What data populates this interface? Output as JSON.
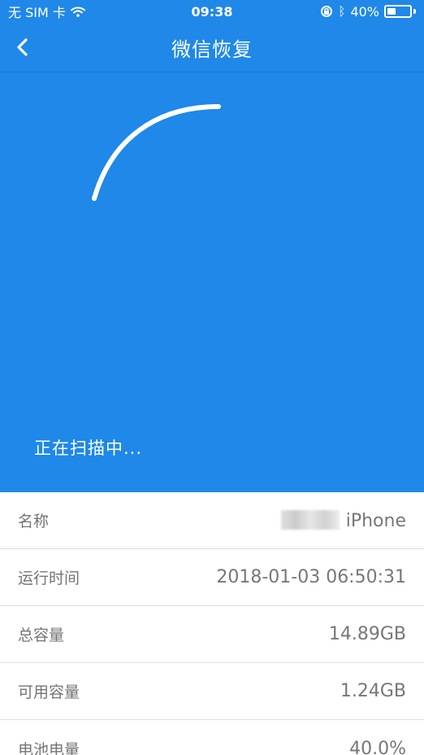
{
  "status": {
    "carrier": "无 SIM 卡",
    "time": "09:38",
    "battery": "40%",
    "battery_level": 0.4,
    "icons": [
      "wifi-icon",
      "rotation-lock-icon",
      "bluetooth-icon",
      "battery-icon"
    ]
  },
  "nav": {
    "title": "微信恢复",
    "back_icon": "chevron-left-icon"
  },
  "scan": {
    "text": "正在扫描中..."
  },
  "device": [
    {
      "label": "名称",
      "value": "iPhone"
    },
    {
      "label": "运行时间",
      "value": "2018-01-03 06:50:31"
    },
    {
      "label": "总容量",
      "value": "14.89GB"
    },
    {
      "label": "可用容量",
      "value": "1.24GB"
    },
    {
      "label": "电池电量",
      "value": "40.0%"
    }
  ],
  "colors": {
    "primary": "#1f88e8",
    "text_gray": "#747474",
    "divider": "#dedede"
  }
}
